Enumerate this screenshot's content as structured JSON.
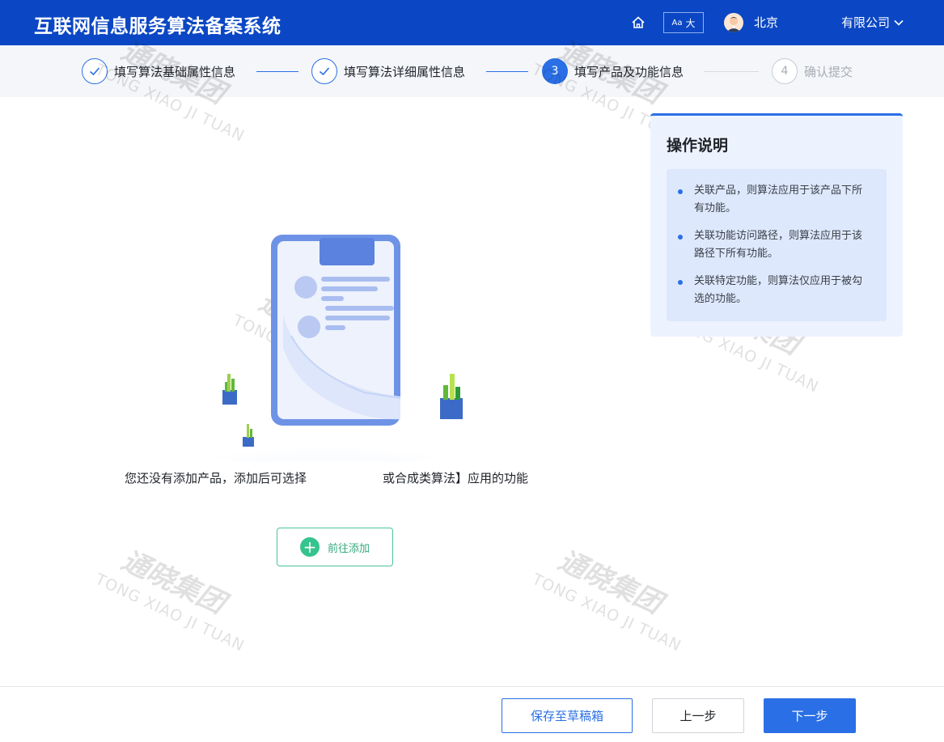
{
  "header": {
    "title": "互联网信息服务算法备案系统",
    "font_toggle_small": "Aa",
    "font_toggle_large": "大",
    "company_visible_start": "北京",
    "company_visible_end": "有限公司"
  },
  "steps": [
    {
      "label": "填写算法基础属性信息",
      "status": "done"
    },
    {
      "label": "填写算法详细属性信息",
      "status": "done"
    },
    {
      "number": "3",
      "label": "填写产品及功能信息",
      "status": "active"
    },
    {
      "number": "4",
      "label": "确认提交",
      "status": "todo"
    }
  ],
  "watermark": {
    "cn": "通晓集团",
    "en": "TONG XIAO JI TUAN"
  },
  "empty_state": {
    "text_part1": "您还没有添加产品，添加后可选择",
    "text_part2": "或合成类算法】应用的功能",
    "add_button": "前往添加"
  },
  "help": {
    "title": "操作说明",
    "items": [
      "关联产品，则算法应用于该产品下所有功能。",
      "关联功能访问路径，则算法应用于该路径下所有功能。",
      "关联特定功能，则算法仅应用于被勾选的功能。"
    ]
  },
  "footer": {
    "save_draft": "保存至草稿箱",
    "prev": "上一步",
    "next": "下一步"
  },
  "colors": {
    "header": "#0b47c4",
    "primary": "#2a6fe6",
    "accent_green": "#35c48d"
  }
}
